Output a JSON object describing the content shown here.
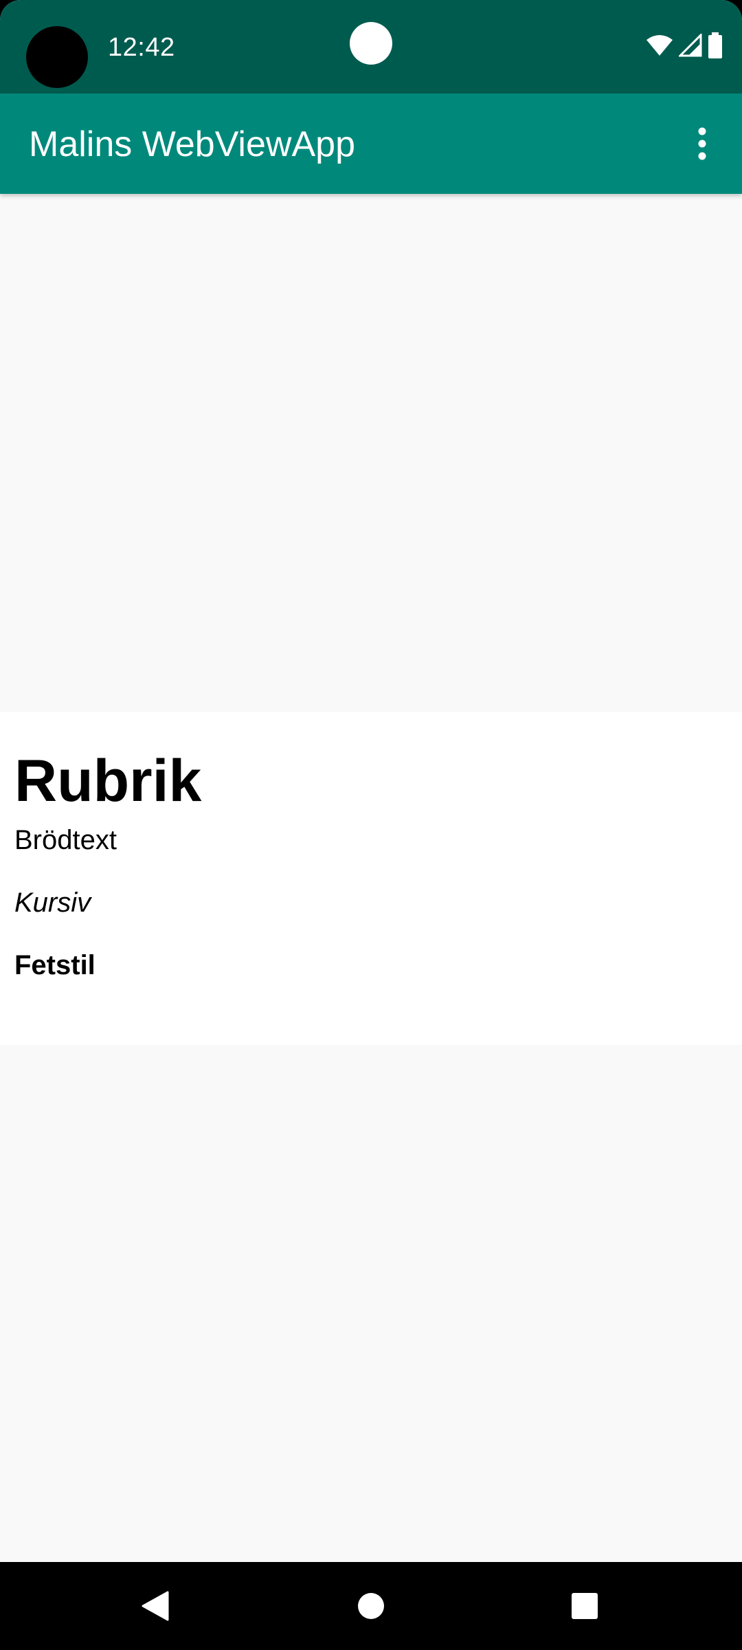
{
  "status_bar": {
    "time": "12:42",
    "icons": [
      "wifi-icon",
      "cell-signal-icon",
      "battery-icon"
    ]
  },
  "app_bar": {
    "title": "Malins WebViewApp",
    "menu_icon": "more-vert-icon",
    "color": "#00897b"
  },
  "web_page": {
    "heading": "Rubrik",
    "paragraph_body": "Brödtext",
    "paragraph_italic": "Kursiv",
    "paragraph_bold": "Fetstil"
  },
  "nav_bar": {
    "icons": [
      "back-icon",
      "home-icon",
      "recents-icon"
    ]
  },
  "colors": {
    "status_bar": "#005b4f",
    "app_bar": "#00897b",
    "background": "#f9f9f9"
  }
}
